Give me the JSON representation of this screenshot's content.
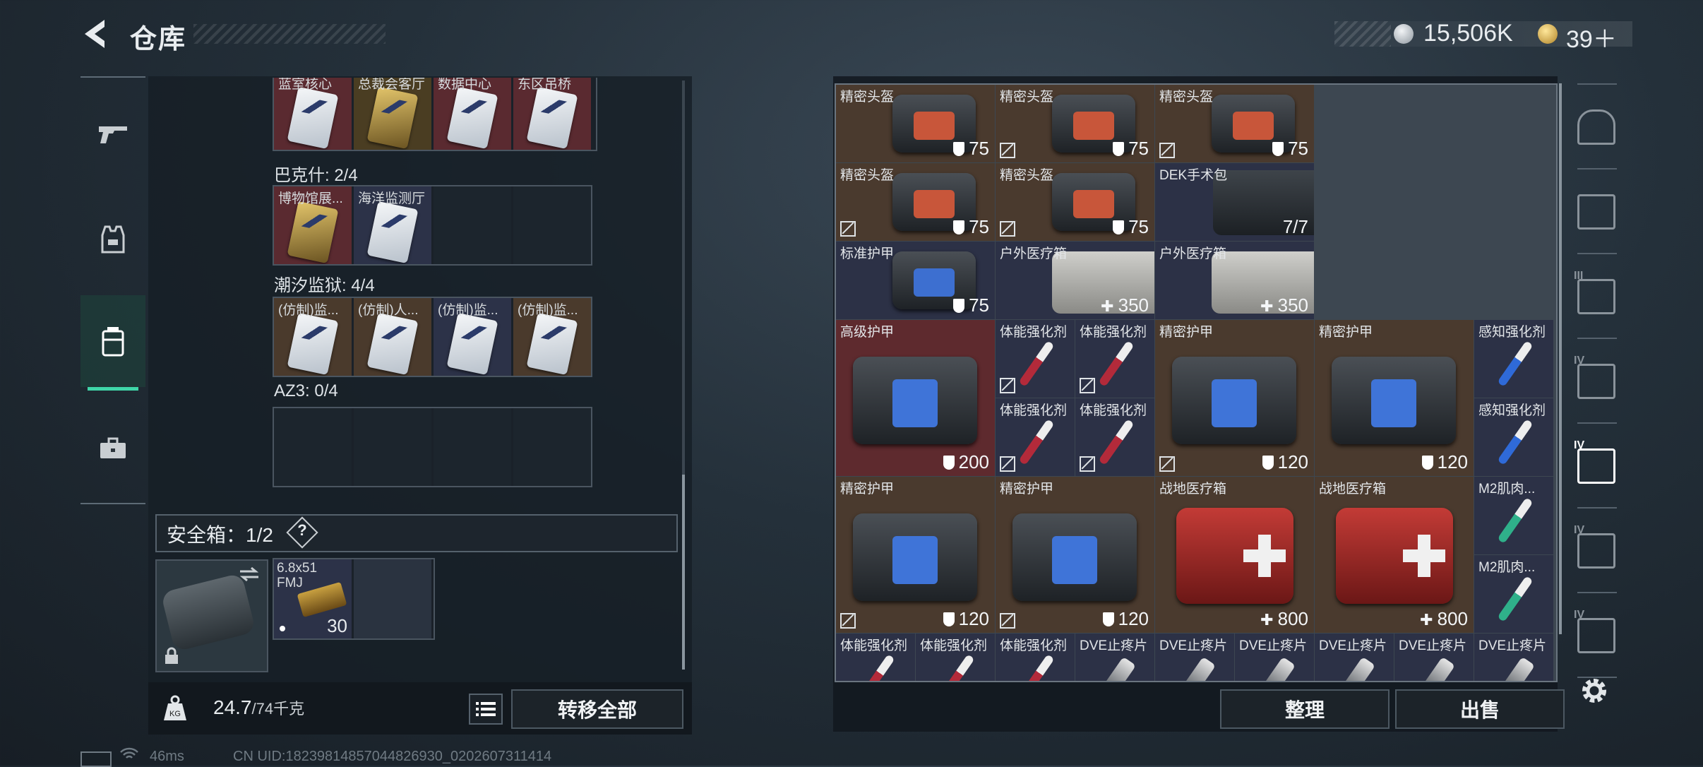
{
  "header": {
    "title": "仓库",
    "currency_amount": "15,506K",
    "secondary_currency": "39＋"
  },
  "nav": {
    "items": [
      {
        "name": "weapons",
        "icon": "gun-icon"
      },
      {
        "name": "equipment",
        "icon": "vest-icon"
      },
      {
        "name": "containers",
        "icon": "canister-icon"
      },
      {
        "name": "toolbox",
        "icon": "briefcase-icon"
      }
    ]
  },
  "keycards": {
    "groups": [
      {
        "label": "",
        "cells": [
          {
            "caption": "蓝室核心",
            "tone": "red",
            "card": "white"
          },
          {
            "caption": "总裁会客厅",
            "tone": "gold",
            "card": "gold"
          },
          {
            "caption": "数据中心",
            "tone": "red",
            "card": "white"
          },
          {
            "caption": "东区吊桥",
            "tone": "red",
            "card": "white"
          }
        ]
      },
      {
        "label": "巴克什: 2/4",
        "cells": [
          {
            "caption": "博物馆展...",
            "tone": "red",
            "card": "gold"
          },
          {
            "caption": "海洋监测厅",
            "tone": "blue",
            "card": "white"
          },
          {
            "caption": "",
            "tone": "empty",
            "card": ""
          },
          {
            "caption": "",
            "tone": "empty",
            "card": ""
          }
        ]
      },
      {
        "label": "潮汐监狱: 4/4",
        "cells": [
          {
            "caption": "(仿制)监...",
            "tone": "brown",
            "card": "white"
          },
          {
            "caption": "(仿制)人...",
            "tone": "brown",
            "card": "white"
          },
          {
            "caption": "(仿制)监...",
            "tone": "blue",
            "card": "white"
          },
          {
            "caption": "(仿制)监...",
            "tone": "brown",
            "card": "white"
          }
        ]
      },
      {
        "label": "AZ3: 0/4",
        "cells": [
          {
            "caption": "",
            "tone": "empty",
            "card": ""
          },
          {
            "caption": "",
            "tone": "empty",
            "card": ""
          },
          {
            "caption": "",
            "tone": "empty",
            "card": ""
          },
          {
            "caption": "",
            "tone": "empty",
            "card": ""
          }
        ]
      }
    ]
  },
  "safebox": {
    "label": "安全箱：1/2",
    "help": "?",
    "ammo_caption": "6.8x51 FMJ",
    "ammo_count": "30"
  },
  "footer_left": {
    "weight": "24.7",
    "weight_max": "/74千克",
    "transfer_all": "转移全部"
  },
  "stash": {
    "items": [
      {
        "caption": "精密头盔",
        "value": "75",
        "tone": "brown",
        "kind": "helmet",
        "col": "1 / span 2",
        "row": "1",
        "mark": false,
        "icon": "shield"
      },
      {
        "caption": "精密头盔",
        "value": "75",
        "tone": "brown",
        "kind": "helmet",
        "col": "3 / span 2",
        "row": "1",
        "mark": true,
        "icon": "shield"
      },
      {
        "caption": "精密头盔",
        "value": "75",
        "tone": "brown",
        "kind": "helmet",
        "col": "5 / span 2",
        "row": "1",
        "mark": true,
        "icon": "shield"
      },
      {
        "caption": "精密头盔",
        "value": "75",
        "tone": "brown",
        "kind": "helmet",
        "col": "1 / span 2",
        "row": "2",
        "mark": true,
        "icon": "shield"
      },
      {
        "caption": "精密头盔",
        "value": "75",
        "tone": "brown",
        "kind": "helmet",
        "col": "3 / span 2",
        "row": "2",
        "mark": true,
        "icon": "shield"
      },
      {
        "caption": "DEK手术包",
        "value": "7/7",
        "tone": "blue",
        "kind": "surgical",
        "col": "5 / span 2",
        "row": "2",
        "mark": false,
        "icon": ""
      },
      {
        "caption": "标准护甲",
        "value": "75",
        "tone": "blue",
        "kind": "armor-small",
        "col": "1 / span 2",
        "row": "3",
        "mark": false,
        "icon": "shield"
      },
      {
        "caption": "户外医疗箱",
        "value": "350",
        "tone": "blue",
        "kind": "pouch",
        "col": "3 / span 2",
        "row": "3",
        "mark": false,
        "icon": "plus"
      },
      {
        "caption": "户外医疗箱",
        "value": "350",
        "tone": "blue",
        "kind": "pouch",
        "col": "5 / span 2",
        "row": "3",
        "mark": false,
        "icon": "plus"
      },
      {
        "caption": "高级护甲",
        "value": "200",
        "tone": "red",
        "kind": "armor",
        "col": "1 / span 2",
        "row": "4 / span 2",
        "mark": false,
        "icon": "shield"
      },
      {
        "caption": "体能强化剂",
        "value": "",
        "tone": "blue",
        "kind": "syringe-red",
        "col": "3",
        "row": "4",
        "mark": true,
        "icon": ""
      },
      {
        "caption": "体能强化剂",
        "value": "",
        "tone": "blue",
        "kind": "syringe-red",
        "col": "4",
        "row": "4",
        "mark": true,
        "icon": ""
      },
      {
        "caption": "体能强化剂",
        "value": "",
        "tone": "blue",
        "kind": "syringe-red",
        "col": "3",
        "row": "5",
        "mark": true,
        "icon": ""
      },
      {
        "caption": "体能强化剂",
        "value": "",
        "tone": "blue",
        "kind": "syringe-red",
        "col": "4",
        "row": "5",
        "mark": true,
        "icon": ""
      },
      {
        "caption": "精密护甲",
        "value": "120",
        "tone": "brown",
        "kind": "armor",
        "col": "5 / span 2",
        "row": "4 / span 2",
        "mark": true,
        "icon": "shield"
      },
      {
        "caption": "精密护甲",
        "value": "120",
        "tone": "brown",
        "kind": "armor",
        "col": "7 / span 2",
        "row": "4 / span 2",
        "mark": false,
        "icon": "shield"
      },
      {
        "caption": "感知强化剂",
        "value": "",
        "tone": "blue",
        "kind": "syringe-blue",
        "col": "9",
        "row": "4",
        "mark": false,
        "icon": ""
      },
      {
        "caption": "感知强化剂",
        "value": "",
        "tone": "blue",
        "kind": "syringe-blue",
        "col": "9",
        "row": "5",
        "mark": false,
        "icon": ""
      },
      {
        "caption": "精密护甲",
        "value": "120",
        "tone": "brown",
        "kind": "armor",
        "col": "1 / span 2",
        "row": "6 / span 2",
        "mark": true,
        "icon": "shield"
      },
      {
        "caption": "精密护甲",
        "value": "120",
        "tone": "brown",
        "kind": "armor",
        "col": "3 / span 2",
        "row": "6 / span 2",
        "mark": true,
        "icon": "shield"
      },
      {
        "caption": "战地医疗箱",
        "value": "800",
        "tone": "brown",
        "kind": "medkit",
        "col": "5 / span 2",
        "row": "6 / span 2",
        "mark": false,
        "icon": "plus"
      },
      {
        "caption": "战地医疗箱",
        "value": "800",
        "tone": "brown",
        "kind": "medkit",
        "col": "7 / span 2",
        "row": "6 / span 2",
        "mark": false,
        "icon": "plus"
      },
      {
        "caption": "M2肌肉...",
        "value": "",
        "tone": "blue",
        "kind": "syringe-green",
        "col": "9",
        "row": "6",
        "mark": false,
        "icon": ""
      },
      {
        "caption": "M2肌肉...",
        "value": "",
        "tone": "blue",
        "kind": "syringe-green",
        "col": "9",
        "row": "7",
        "mark": false,
        "icon": ""
      },
      {
        "caption": "体能强化剂",
        "value": "",
        "tone": "blue",
        "kind": "syringe-red",
        "col": "1",
        "row": "8",
        "mark": false,
        "icon": ""
      },
      {
        "caption": "体能强化剂",
        "value": "",
        "tone": "blue",
        "kind": "syringe-red",
        "col": "2",
        "row": "8",
        "mark": false,
        "icon": ""
      },
      {
        "caption": "体能强化剂",
        "value": "",
        "tone": "blue",
        "kind": "syringe-red",
        "col": "3",
        "row": "8",
        "mark": false,
        "icon": ""
      },
      {
        "caption": "DVE止疼片",
        "value": "",
        "tone": "blue",
        "kind": "pill",
        "col": "4",
        "row": "8",
        "mark": false,
        "icon": ""
      },
      {
        "caption": "DVE止疼片",
        "value": "",
        "tone": "blue",
        "kind": "pill",
        "col": "5",
        "row": "8",
        "mark": false,
        "icon": ""
      },
      {
        "caption": "DVE止疼片",
        "value": "",
        "tone": "blue",
        "kind": "pill",
        "col": "6",
        "row": "8",
        "mark": false,
        "icon": ""
      },
      {
        "caption": "DVE止疼片",
        "value": "",
        "tone": "blue",
        "kind": "pill",
        "col": "7",
        "row": "8",
        "mark": false,
        "icon": ""
      },
      {
        "caption": "DVE止疼片",
        "value": "",
        "tone": "blue",
        "kind": "pill",
        "col": "8",
        "row": "8",
        "mark": false,
        "icon": ""
      },
      {
        "caption": "DVE止疼片",
        "value": "",
        "tone": "blue",
        "kind": "pill",
        "col": "9",
        "row": "8",
        "mark": false,
        "icon": ""
      }
    ]
  },
  "footer_right": {
    "sort": "整理",
    "sell": "出售"
  },
  "right_tabs": [
    {
      "icon": "dome-icon",
      "label": ""
    },
    {
      "icon": "vest-tier-icon",
      "label": ""
    },
    {
      "icon": "rifle-tier-icon",
      "label": "III"
    },
    {
      "icon": "folder-tier-icon",
      "label": "IV"
    },
    {
      "icon": "medkit-tier-icon",
      "label": "IV"
    },
    {
      "icon": "scope-tier-icon",
      "label": "IV"
    },
    {
      "icon": "scope-tier-icon-2",
      "label": "IV"
    }
  ],
  "status": {
    "ping": "46ms",
    "uid": "CN UID:18239814857044826930_0202607311414"
  },
  "colors": {
    "accent": "#3fd6a8",
    "tone_brown": "#4a3a2e",
    "tone_blue": "#2c3146",
    "tone_red": "#5e2a2e"
  }
}
